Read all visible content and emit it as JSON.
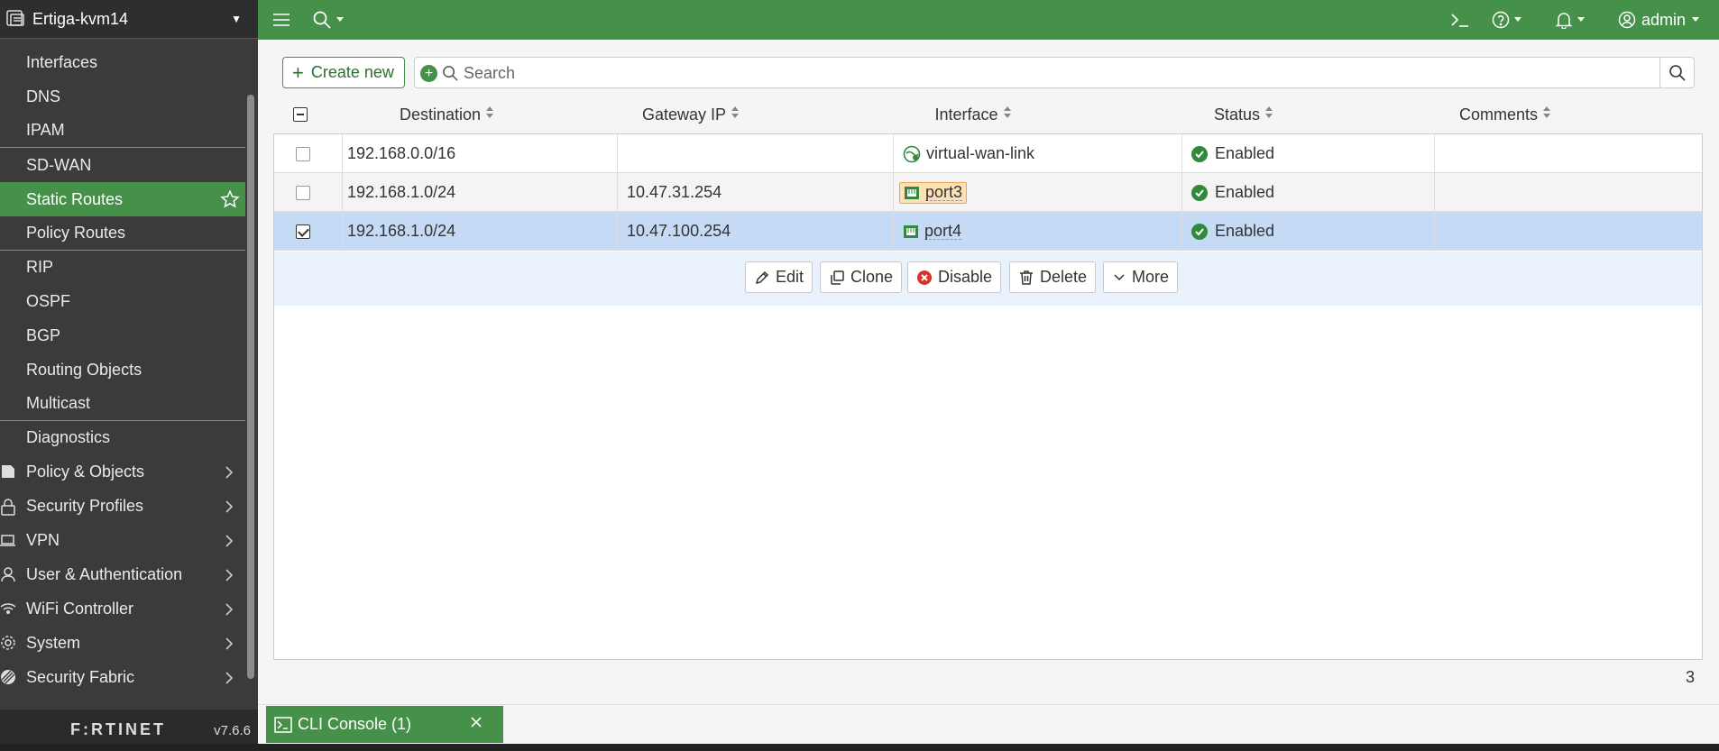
{
  "sidebar": {
    "device_name": "Ertiga-kvm14",
    "sub_items": [
      {
        "label": "Interfaces"
      },
      {
        "label": "DNS"
      },
      {
        "label": "IPAM"
      },
      {
        "label": "SD-WAN"
      },
      {
        "label": "Static Routes"
      },
      {
        "label": "Policy Routes"
      },
      {
        "label": "RIP"
      },
      {
        "label": "OSPF"
      },
      {
        "label": "BGP"
      },
      {
        "label": "Routing Objects"
      },
      {
        "label": "Multicast"
      },
      {
        "label": "Diagnostics"
      }
    ],
    "active_item": "Static Routes",
    "main_items": [
      {
        "label": "Policy & Objects",
        "icon": "policy-icon"
      },
      {
        "label": "Security Profiles",
        "icon": "lock-icon"
      },
      {
        "label": "VPN",
        "icon": "laptop-icon"
      },
      {
        "label": "User & Authentication",
        "icon": "user-icon"
      },
      {
        "label": "WiFi Controller",
        "icon": "wifi-icon"
      },
      {
        "label": "System",
        "icon": "gear-icon"
      },
      {
        "label": "Security Fabric",
        "icon": "fabric-icon"
      }
    ],
    "logo": "F:RTINET",
    "version": "v7.6.6"
  },
  "topbar": {
    "admin_label": "admin"
  },
  "toolbar": {
    "create_label": "Create new",
    "search_placeholder": "Search"
  },
  "table": {
    "columns": [
      "Destination",
      "Gateway IP",
      "Interface",
      "Status",
      "Comments"
    ],
    "rows": [
      {
        "destination": "192.168.0.0/16",
        "gateway": "",
        "interface": "virtual-wan-link",
        "status": "Enabled",
        "comments": "",
        "selected": false
      },
      {
        "destination": "192.168.1.0/24",
        "gateway": "10.47.31.254",
        "interface": "port3",
        "status": "Enabled",
        "comments": "",
        "selected": false
      },
      {
        "destination": "192.168.1.0/24",
        "gateway": "10.47.100.254",
        "interface": "port4",
        "status": "Enabled",
        "comments": "",
        "selected": true
      }
    ],
    "actions": [
      "Edit",
      "Clone",
      "Disable",
      "Delete",
      "More"
    ],
    "count": "3"
  },
  "console": {
    "tab_label": "CLI Console (1)"
  },
  "colors": {
    "brand_green": "#46914a",
    "sidebar_bg": "#3b3b3b",
    "selected_row": "#c5daf5",
    "status_ok": "#2f8a3c"
  }
}
